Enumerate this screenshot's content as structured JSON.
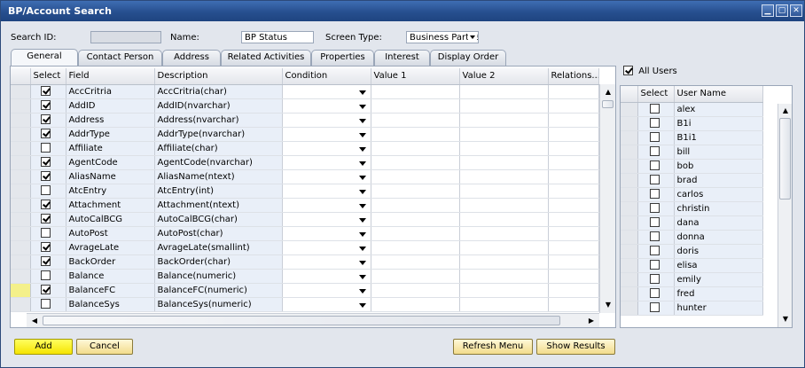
{
  "window": {
    "title": "BP/Account Search",
    "buttons": [
      "▁",
      "▢",
      "✕"
    ]
  },
  "header": {
    "search_id_label": "Search ID:",
    "search_id_value": "",
    "name_label": "Name:",
    "name_value": "BP Status",
    "screen_type_label": "Screen Type:",
    "screen_type_value": "Business Partne"
  },
  "tabs": [
    "General",
    "Contact Person",
    "Address",
    "Related Activities",
    "Properties",
    "Interest",
    "Display Order"
  ],
  "active_tab": "General",
  "grid": {
    "columns": [
      "Select",
      "Field",
      "Description",
      "Condition",
      "Value 1",
      "Value 2",
      "Relations..."
    ],
    "rows": [
      {
        "checked": true,
        "field": "AccCritria",
        "description": "AccCritria(char)"
      },
      {
        "checked": true,
        "field": "AddID",
        "description": "AddID(nvarchar)"
      },
      {
        "checked": true,
        "field": "Address",
        "description": "Address(nvarchar)"
      },
      {
        "checked": true,
        "field": "AddrType",
        "description": "AddrType(nvarchar)"
      },
      {
        "checked": false,
        "field": "Affiliate",
        "description": "Affiliate(char)"
      },
      {
        "checked": true,
        "field": "AgentCode",
        "description": "AgentCode(nvarchar)"
      },
      {
        "checked": true,
        "field": "AliasName",
        "description": "AliasName(ntext)"
      },
      {
        "checked": false,
        "field": "AtcEntry",
        "description": "AtcEntry(int)"
      },
      {
        "checked": true,
        "field": "Attachment",
        "description": "Attachment(ntext)"
      },
      {
        "checked": true,
        "field": "AutoCalBCG",
        "description": "AutoCalBCG(char)"
      },
      {
        "checked": false,
        "field": "AutoPost",
        "description": "AutoPost(char)"
      },
      {
        "checked": true,
        "field": "AvrageLate",
        "description": "AvrageLate(smallint)"
      },
      {
        "checked": true,
        "field": "BackOrder",
        "description": "BackOrder(char)"
      },
      {
        "checked": false,
        "field": "Balance",
        "description": "Balance(numeric)"
      },
      {
        "checked": true,
        "field": "BalanceFC",
        "description": "BalanceFC(numeric)"
      },
      {
        "checked": false,
        "field": "BalanceSys",
        "description": "BalanceSys(numeric)"
      }
    ]
  },
  "users": {
    "all_users_label": "All Users",
    "all_users_checked": true,
    "columns": [
      "Select",
      "User Name"
    ],
    "rows": [
      "alex",
      "B1i",
      "B1i1",
      "bill",
      "bob",
      "brad",
      "carlos",
      "christin",
      "dana",
      "donna",
      "doris",
      "elisa",
      "emily",
      "fred",
      "hunter"
    ]
  },
  "footer": {
    "add_label": "Add",
    "cancel_label": "Cancel",
    "refresh_label": "Refresh Menu",
    "show_results_label": "Show Results"
  },
  "colors": {
    "title_bar": "#274f8f",
    "primary_button": "#f5e400",
    "field_column": "#e9eff8"
  }
}
